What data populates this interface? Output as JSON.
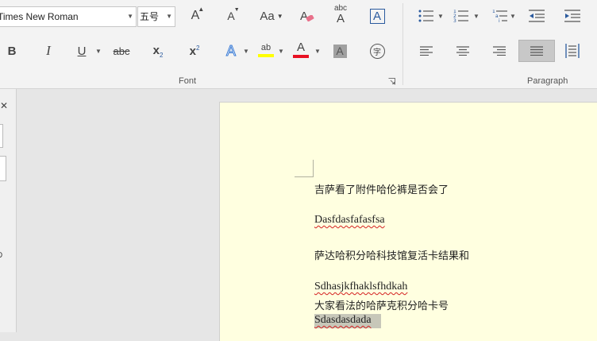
{
  "ribbon": {
    "font_group": {
      "label": "Font",
      "font_name": "Times New Roman",
      "font_size": "五号",
      "grow_font_glyph": "A",
      "shrink_font_glyph": "A",
      "change_case_label": "Aa",
      "clear_format_glyph": "A",
      "phonetic_top": "abc",
      "phonetic_bottom": "A",
      "char_border_glyph": "A",
      "bold_label": "B",
      "italic_label": "I",
      "underline_label": "U",
      "strike_label": "abc",
      "subscript_label": "x",
      "subscript_mark": "2",
      "superscript_label": "x",
      "superscript_mark": "2",
      "text_effects_glyph": "A",
      "highlight_glyph": "ab",
      "font_color_glyph": "A",
      "char_shading_glyph": "A",
      "enclose_char_glyph": "字",
      "highlight_color": "#ffff00",
      "font_color": "#e81123"
    },
    "paragraph_group": {
      "label": "Paragraph"
    }
  },
  "leftpane": {
    "close_glyph": "✕",
    "side_mark": "D"
  },
  "document": {
    "lines": [
      {
        "text": "吉萨看了附件哈伦裤是否会了",
        "cn": true
      },
      {
        "text": "Dasfdasfafasfsa",
        "cn": false,
        "squiggle": true
      },
      {
        "text": "萨达哈积分哈科技馆复活卡结果和",
        "cn": true
      },
      {
        "text": "Sdhasjkfhaklsfhdkah",
        "cn": false,
        "squiggle": true
      },
      {
        "text": "大家看法的哈萨克积分哈卡号",
        "cn": true
      },
      {
        "text": "Sdasdasdada",
        "cn": false,
        "squiggle": true,
        "selected": true
      }
    ]
  }
}
